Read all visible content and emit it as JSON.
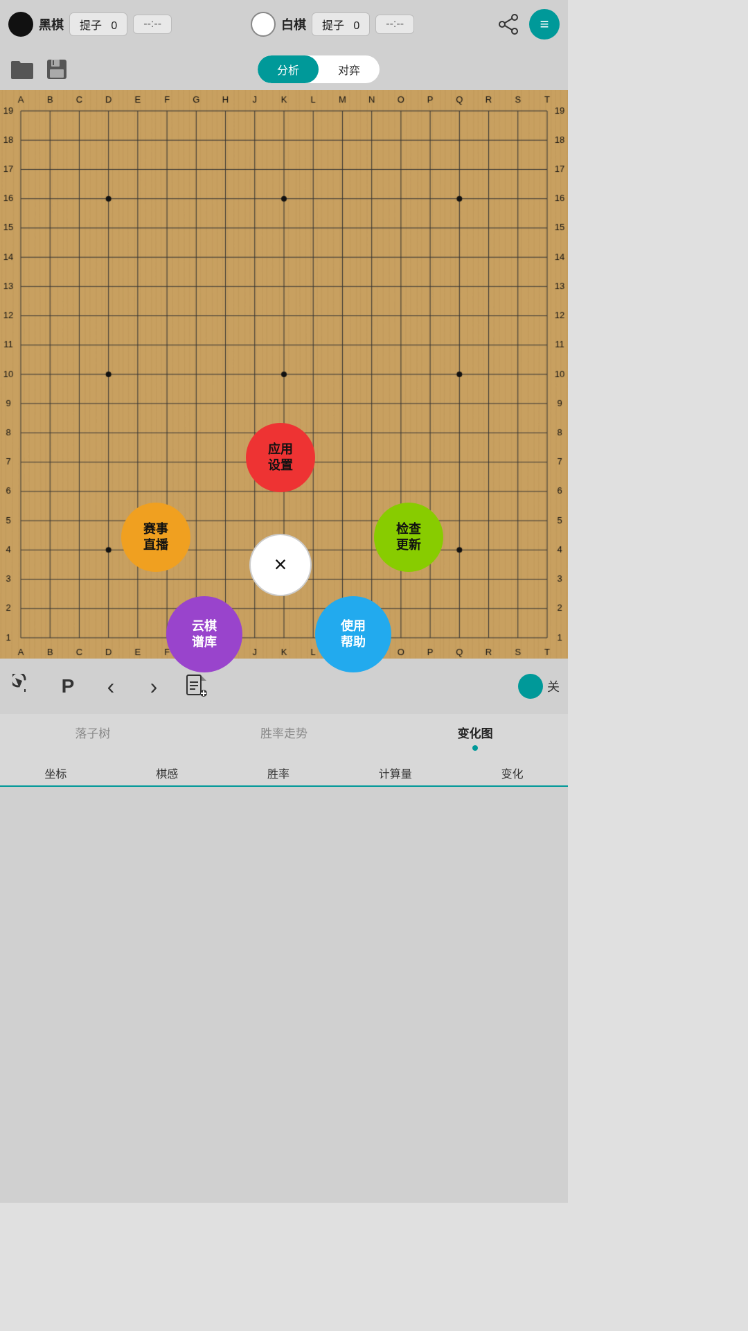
{
  "header": {
    "black_label": "黑棋",
    "white_label": "白棋",
    "black_capture_label": "提子",
    "white_capture_label": "提子",
    "black_capture_value": "0",
    "white_capture_value": "0",
    "black_time": "--:--",
    "white_time": "--:--"
  },
  "toolbar": {
    "mode_analysis": "分析",
    "mode_opponent": "对弈",
    "active_mode": "analysis"
  },
  "board": {
    "cols": [
      "A",
      "B",
      "C",
      "D",
      "E",
      "F",
      "G",
      "H",
      "J",
      "K",
      "L",
      "M",
      "N",
      "O",
      "P",
      "Q",
      "R",
      "S",
      "T"
    ],
    "rows": [
      19,
      18,
      17,
      16,
      15,
      14,
      13,
      12,
      11,
      10,
      9,
      8,
      7,
      6,
      5,
      4,
      3,
      2,
      1
    ],
    "star_points": [
      [
        4,
        4
      ],
      [
        4,
        10
      ],
      [
        4,
        16
      ],
      [
        10,
        4
      ],
      [
        10,
        10
      ],
      [
        10,
        16
      ],
      [
        16,
        4
      ],
      [
        16,
        10
      ],
      [
        16,
        16
      ]
    ]
  },
  "radial_menu": {
    "center": {
      "label": "×",
      "color": "#ffffff",
      "size": 90
    },
    "top": {
      "label": "应用\n设置",
      "color": "#ee3333",
      "size": 100
    },
    "left": {
      "label": "赛事\n直播",
      "color": "#f0a020",
      "size": 100
    },
    "right": {
      "label": "检查\n更新",
      "color": "#88cc00",
      "size": 100
    },
    "bottom_left": {
      "label": "云棋\n谱库",
      "color": "#9944cc",
      "size": 110
    },
    "bottom_right": {
      "label": "使用\n帮助",
      "color": "#22aaee",
      "size": 110
    }
  },
  "bottom_controls": {
    "undo_label": "↺",
    "pass_label": "P",
    "next_label": "›",
    "prev_label": "‹",
    "toggle_label": "关",
    "doc_label": "📄"
  },
  "analysis_tabs": [
    {
      "label": "落子树",
      "active": false
    },
    {
      "label": "胜率走势",
      "active": false
    },
    {
      "label": "变化图",
      "active": true
    }
  ],
  "sub_tabs": [
    {
      "label": "坐标"
    },
    {
      "label": "棋感"
    },
    {
      "label": "胜率"
    },
    {
      "label": "计算量"
    },
    {
      "label": "变化"
    }
  ],
  "icons": {
    "folder": "📂",
    "save": "💾",
    "share": "⬆",
    "menu": "≡"
  }
}
